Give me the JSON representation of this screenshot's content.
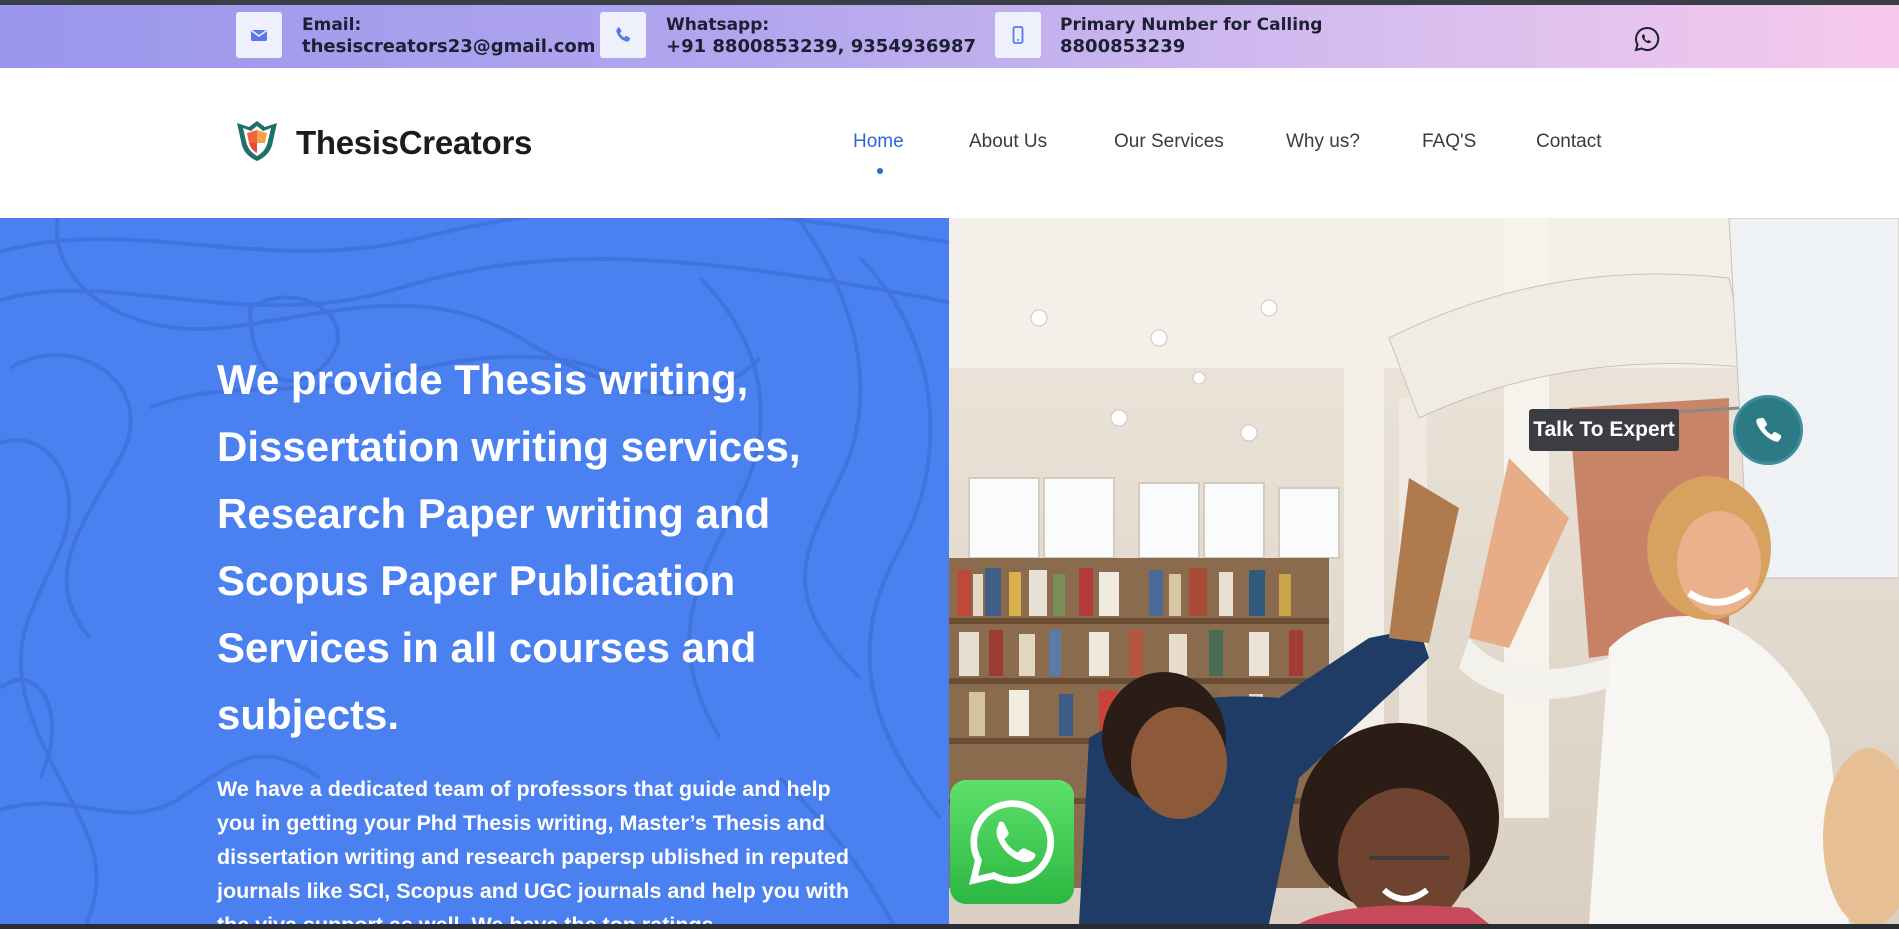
{
  "contact_bar": {
    "email": {
      "label": "Email:",
      "value": "thesiscreators23@gmail.com",
      "icon": "envelope-icon"
    },
    "whatsapp": {
      "label": "Whatsapp:",
      "value": "+91 8800853239, 9354936987",
      "icon": "phone-icon"
    },
    "calling": {
      "label": "Primary Number for Calling",
      "value": "8800853239",
      "icon": "mobile-icon"
    },
    "social_icon": "whatsapp-icon"
  },
  "header": {
    "logo_text": "ThesisCreators",
    "nav": [
      "Home",
      "About Us",
      "Our Services",
      "Why us?",
      "FAQ'S",
      "Contact"
    ],
    "active_index": 0
  },
  "hero": {
    "title": "We provide Thesis writing, Dissertation writing services, Research Paper writing and Scopus Paper Publication Services in all courses and subjects.",
    "description": "We have a dedicated team of professors that guide and help you in getting your Phd Thesis writing, Master’s Thesis and dissertation writing and research papersp ublished in reputed journals like SCI, Scopus and UGC journals and help you with the viva support as well. We have the top ratings",
    "talk_to_expert": "Talk To Expert"
  },
  "colors": {
    "accent": "#2f66d6",
    "hero_bg": "#4a80f0",
    "whatsapp_green": "#2bb741",
    "call_button": "#2c7a86"
  }
}
